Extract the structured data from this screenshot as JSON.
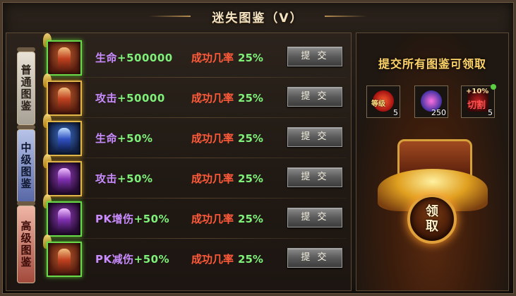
{
  "title": "迷失图鉴（V）",
  "tiers": [
    {
      "chars": [
        "普",
        "通",
        "图",
        "鉴"
      ]
    },
    {
      "chars": [
        "中",
        "级",
        "图",
        "鉴"
      ]
    },
    {
      "chars": [
        "高",
        "级",
        "图",
        "鉴"
      ]
    }
  ],
  "rows": [
    {
      "name": "生命",
      "value": "+500000",
      "rate_label": "成功几率",
      "rate": "25%",
      "button": "提 交"
    },
    {
      "name": "攻击",
      "value": "+50000",
      "rate_label": "成功几率",
      "rate": "25%",
      "button": "提 交"
    },
    {
      "name": "生命",
      "value": "+50%",
      "rate_label": "成功几率",
      "rate": "25%",
      "button": "提 交"
    },
    {
      "name": "攻击",
      "value": "+50%",
      "rate_label": "成功几率",
      "rate": "25%",
      "button": "提 交"
    },
    {
      "name": "PK增伤",
      "value": "+50%",
      "rate_label": "成功几率",
      "rate": "25%",
      "button": "提 交"
    },
    {
      "name": "PK减伤",
      "value": "+50%",
      "rate_label": "成功几率",
      "rate": "25%",
      "button": "提 交"
    }
  ],
  "reward_panel": {
    "title": "提交所有图鉴可领取",
    "rewards": [
      {
        "icon": "level-medal-icon",
        "tag": "等级",
        "count": "5"
      },
      {
        "icon": "gem-bundle-icon",
        "count": "250"
      },
      {
        "icon": "cut-bonus-icon",
        "plus": "+10%",
        "sub": "切割",
        "count": "5"
      }
    ],
    "claim": [
      "领",
      "取"
    ]
  },
  "colors": {
    "attr_name": "#c98cff",
    "attr_value": "#7ff07a",
    "rate_label": "#ff5a3a",
    "panel_title": "#ffd56a"
  }
}
